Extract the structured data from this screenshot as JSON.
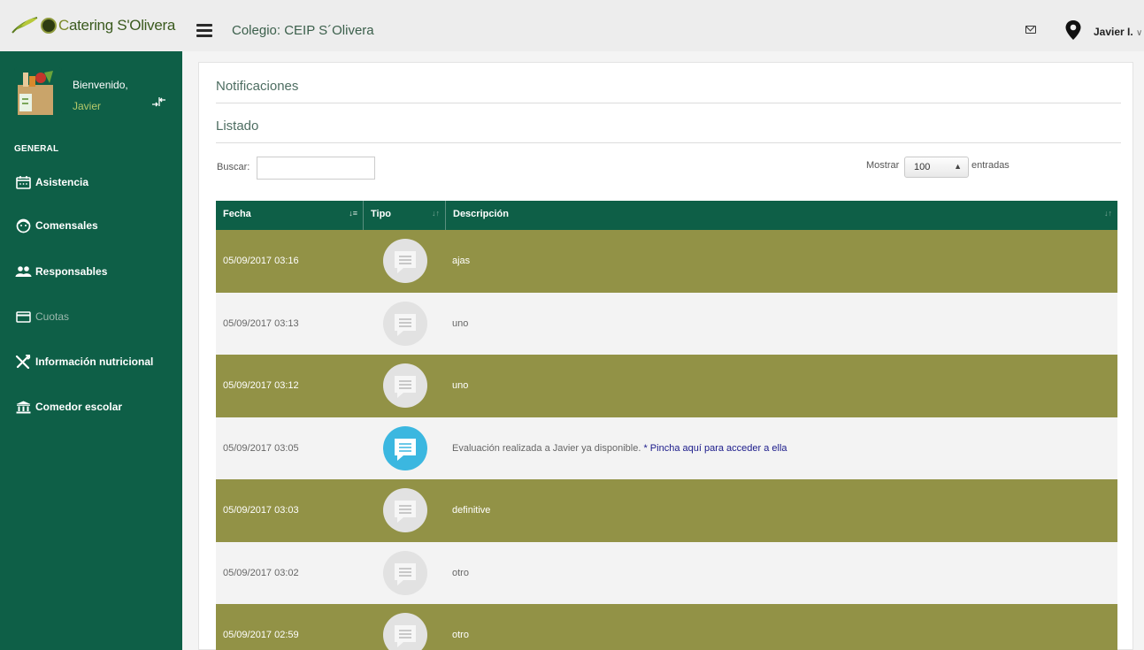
{
  "brand": {
    "name_prefix": "C",
    "name_rest": "atering S'Olivera"
  },
  "header": {
    "title": "Colegio: CEIP S´Olivera",
    "user": "Javier I.",
    "user_chevron": "∨"
  },
  "sidebar": {
    "welcome": "Bienvenido,",
    "user_name": "Javier",
    "section": "GENERAL",
    "items": [
      {
        "label": "Asistencia",
        "icon": "calendar-icon",
        "active": true
      },
      {
        "label": "Comensales",
        "icon": "face-icon",
        "active": true
      },
      {
        "label": "Responsables",
        "icon": "people-icon",
        "active": true
      },
      {
        "label": "Cuotas",
        "icon": "card-icon",
        "active": false
      },
      {
        "label": "Información nutricional",
        "icon": "cutlery-icon",
        "active": true
      },
      {
        "label": "Comedor escolar",
        "icon": "institution-icon",
        "active": true
      }
    ]
  },
  "main": {
    "title": "Notificaciones",
    "subtitle": "Listado",
    "search_label": "Buscar:",
    "search_value": "",
    "show_label": "Mostrar",
    "show_value": "100",
    "entries_label": "entradas"
  },
  "table": {
    "columns": [
      {
        "label": "Fecha",
        "sort": "↓≡"
      },
      {
        "label": "Tipo",
        "sort": "↓↑"
      },
      {
        "label": "Descripción",
        "sort": "↓↑"
      }
    ],
    "rows": [
      {
        "date": "05/09/2017 03:16",
        "type": "message-icon",
        "desc": "ajas",
        "link": ""
      },
      {
        "date": "05/09/2017 03:13",
        "type": "message-icon",
        "desc": "uno",
        "link": ""
      },
      {
        "date": "05/09/2017 03:12",
        "type": "message-icon",
        "desc": "uno",
        "link": ""
      },
      {
        "date": "05/09/2017 03:05",
        "type": "message-icon",
        "desc": "Evaluación realizada a Javier ya disponible.",
        "link": "* Pincha aquí para acceder a ella",
        "highlight": true
      },
      {
        "date": "05/09/2017 03:03",
        "type": "message-icon",
        "desc": "definitive",
        "link": ""
      },
      {
        "date": "05/09/2017 03:02",
        "type": "message-icon",
        "desc": "otro",
        "link": ""
      },
      {
        "date": "05/09/2017 02:59",
        "type": "message-icon",
        "desc": "otro",
        "link": ""
      }
    ]
  },
  "colors": {
    "sidebar": "#0e5f47",
    "olive_row": "#929246",
    "light_row": "#f3f3f3",
    "icon_blue": "#3bb7e0",
    "icon_gray": "#e2e2e2",
    "accent_green": "#b5c96a"
  }
}
